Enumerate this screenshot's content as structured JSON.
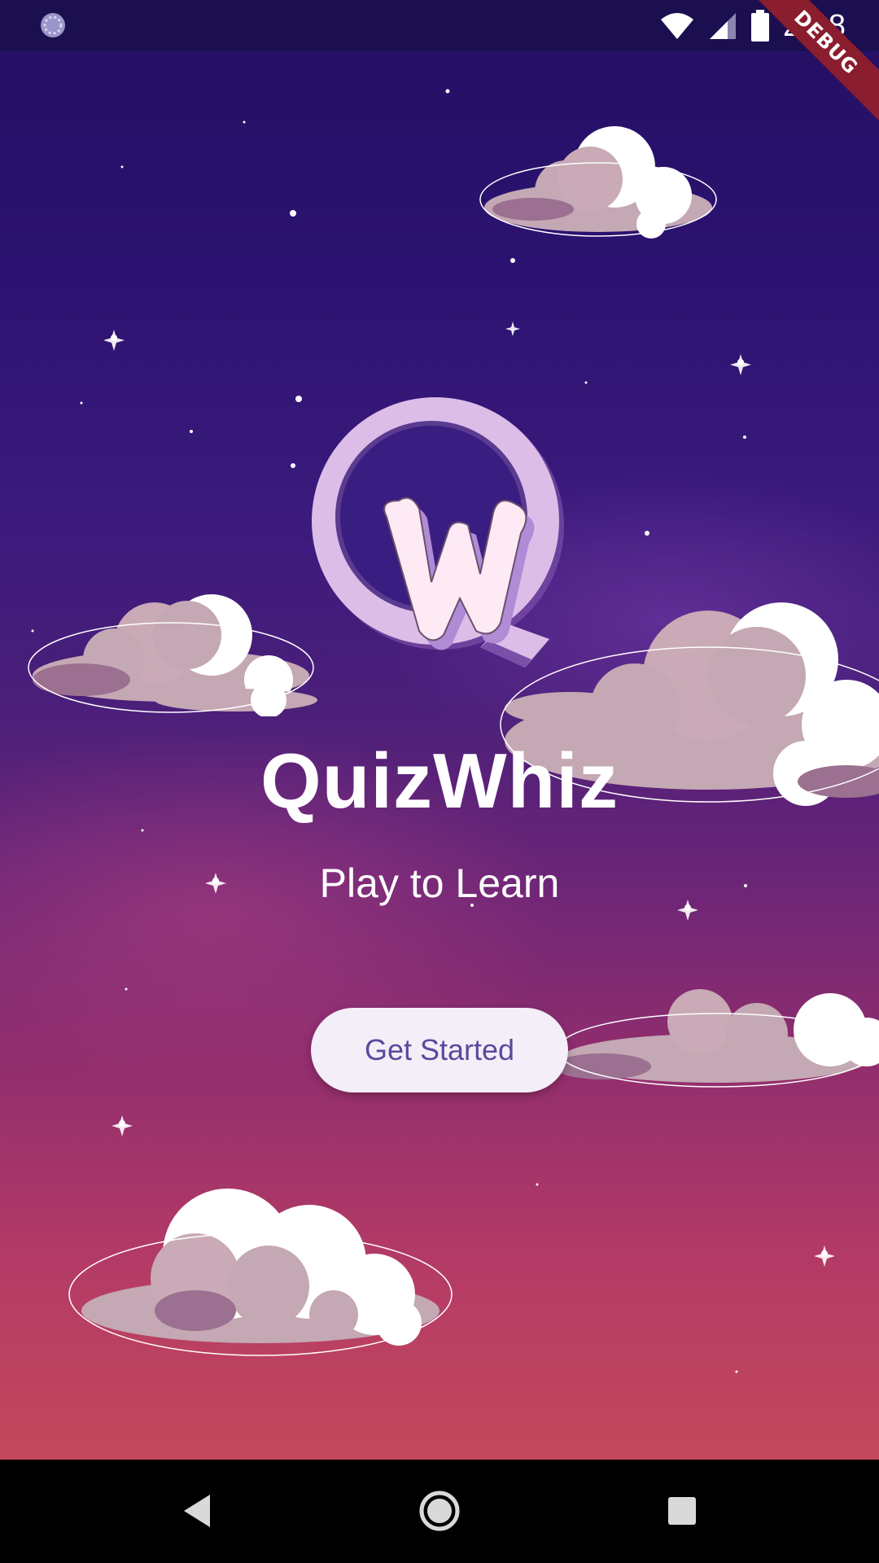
{
  "status_bar": {
    "time": "2:18",
    "debug_label": "DEBUG",
    "icons": [
      "loading-icon",
      "wifi-icon",
      "signal-icon",
      "battery-icon"
    ]
  },
  "app": {
    "title": "QuizWhiz",
    "subtitle": "Play to Learn",
    "cta_label": "Get Started"
  },
  "navigation": {
    "buttons": [
      "back-icon",
      "home-icon",
      "recents-icon"
    ]
  },
  "colors": {
    "button_background": "#f3eef8",
    "button_text": "#5a4a9c",
    "logo_ring": "#dcbde8",
    "sky_top": "#231063",
    "sky_bottom": "#c4485c"
  }
}
